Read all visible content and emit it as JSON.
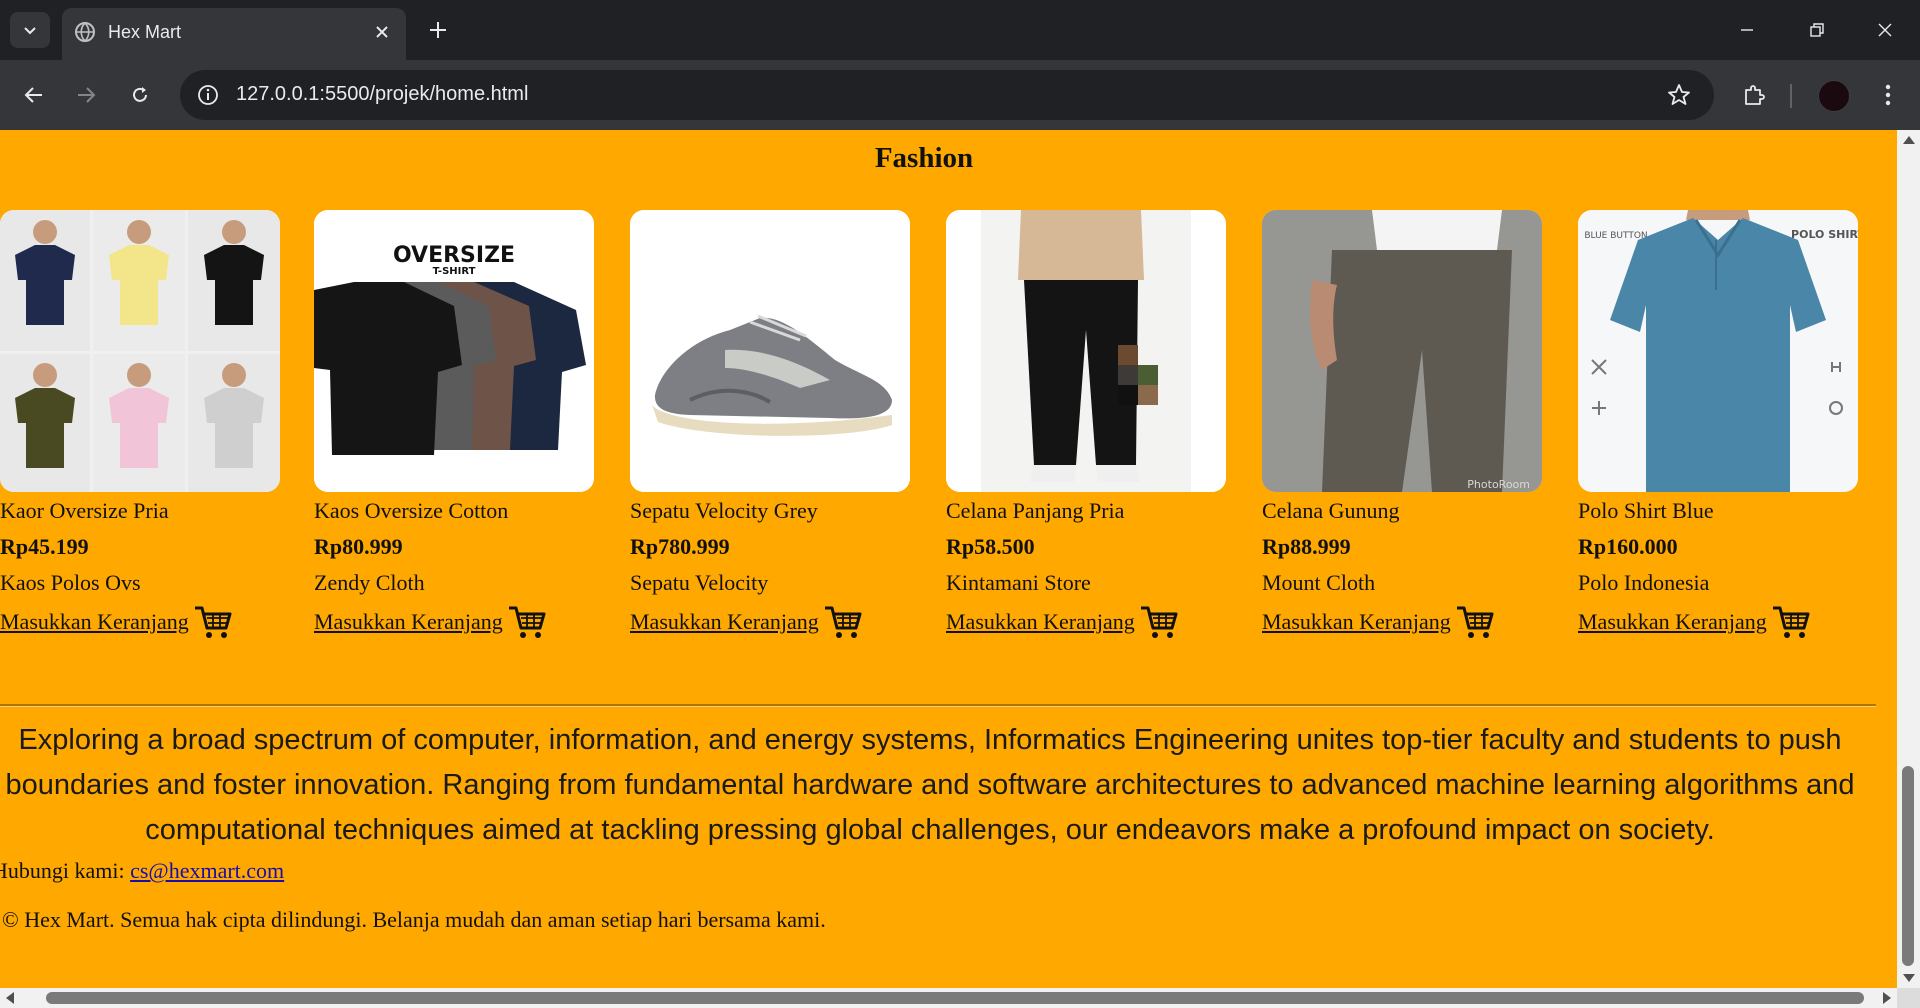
{
  "browser": {
    "tab_title": "Hex Mart",
    "url": "127.0.0.1:5500/projek/home.html",
    "icons": [
      "chevron-down-icon",
      "globe-icon",
      "close-icon",
      "plus-icon",
      "minimize-icon",
      "restore-icon",
      "close-window-icon",
      "back-arrow-icon",
      "forward-arrow-icon",
      "reload-icon",
      "info-icon",
      "bookmark-star-icon",
      "extensions-puzzle-icon",
      "profile-avatar",
      "kebab-menu-icon"
    ]
  },
  "page": {
    "section_title": "Fashion",
    "cart_label": "Masukkan Keranjang ",
    "products": [
      {
        "name": "Kaor Oversize Pria",
        "price": "Rp45.199",
        "store": "Kaos Polos Ovs"
      },
      {
        "name": "Kaos Oversize Cotton",
        "price": "Rp80.999",
        "store": "Zendy Cloth",
        "image_text": "OVERSIZE",
        "image_subtext": "T-SHIRT"
      },
      {
        "name": "Sepatu Velocity Grey",
        "price": "Rp780.999",
        "store": "Sepatu Velocity"
      },
      {
        "name": "Celana Panjang Pria",
        "price": "Rp58.500",
        "store": "Kintamani Store"
      },
      {
        "name": "Celana Gunung",
        "price": "Rp88.999",
        "store": "Mount Cloth",
        "image_text": "PhotoRoom"
      },
      {
        "name": "Polo Shirt Blue",
        "price": "Rp160.000",
        "store": "Polo Indonesia",
        "image_text_left": "BLUE BUTTON",
        "image_text_right": "POLO SHIRT"
      }
    ],
    "about": "Exploring a broad spectrum of computer, information, and energy systems, Informatics Engineering unites top-tier faculty and students to push boundaries and foster innovation. Ranging from fundamental hardware and software architectures to advanced machine learning algorithms and computational techniques aimed at tackling pressing global challenges, our endeavors make a profound impact on society.",
    "contact_label": "Hubungi kami: ",
    "contact_email": "cs@hexmart.com",
    "copyright": "© Hex Mart. Semua hak cipta dilindungi. Belanja mudah dan aman setiap hari bersama kami."
  },
  "colors": {
    "page_background": "#ffa800",
    "chrome_dark": "#202124",
    "chrome_toolbar": "#35363a",
    "link": "#1a0dab"
  }
}
